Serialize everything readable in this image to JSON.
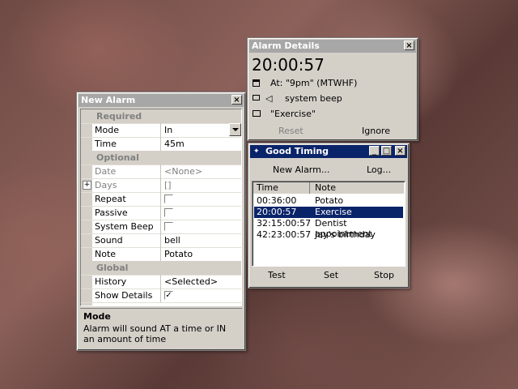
{
  "new_alarm": {
    "title": "New Alarm",
    "close": "×",
    "sections": {
      "required": "Required",
      "optional": "Optional",
      "global": "Global"
    },
    "rows": {
      "mode": {
        "label": "Mode",
        "value": "In"
      },
      "time": {
        "label": "Time",
        "value": "45m"
      },
      "date": {
        "label": "Date",
        "value": "<None>"
      },
      "days": {
        "label": "Days",
        "value": "[]"
      },
      "repeat": {
        "label": "Repeat",
        "checked": false
      },
      "passive": {
        "label": "Passive",
        "checked": false
      },
      "system_beep": {
        "label": "System Beep",
        "checked": false
      },
      "sound": {
        "label": "Sound",
        "value": "bell"
      },
      "note": {
        "label": "Note",
        "value": "Potato"
      },
      "history": {
        "label": "History",
        "value": "<Selected>"
      },
      "show_details": {
        "label": "Show Details",
        "checked": true
      }
    },
    "expand_glyph": "+",
    "check_glyph": "✓",
    "help_title": "Mode",
    "help_text": "Alarm will sound AT a time or IN an amount of time"
  },
  "alarm_details": {
    "title": "Alarm Details",
    "close": "×",
    "time": "20:00:57",
    "at_text": "At: \"9pm\" (MTWHF)",
    "sound_text": "system beep",
    "note_text": "\"Exercise\"",
    "reset": "Reset",
    "ignore": "Ignore"
  },
  "good_timing": {
    "title": "Good Timing",
    "new_alarm": "New Alarm...",
    "log": "Log...",
    "columns": [
      "Time",
      "Note"
    ],
    "alarms": [
      {
        "time": "00:36:00",
        "note": "Potato",
        "selected": false
      },
      {
        "time": "20:00:57",
        "note": "Exercise",
        "selected": true
      },
      {
        "time": "32:15:00:57",
        "note": "Dentist appointment",
        "selected": false
      },
      {
        "time": "42:23:00:57",
        "note": "Jay's birthday",
        "selected": false
      }
    ],
    "test": "Test",
    "set": "Set",
    "stop": "Stop",
    "min": "_",
    "max": "□",
    "close": "×"
  },
  "colors": {
    "selection": "#0a246a",
    "titlebar_inactive": "#a7a7a7",
    "titlebar_active": "#0a246a"
  }
}
